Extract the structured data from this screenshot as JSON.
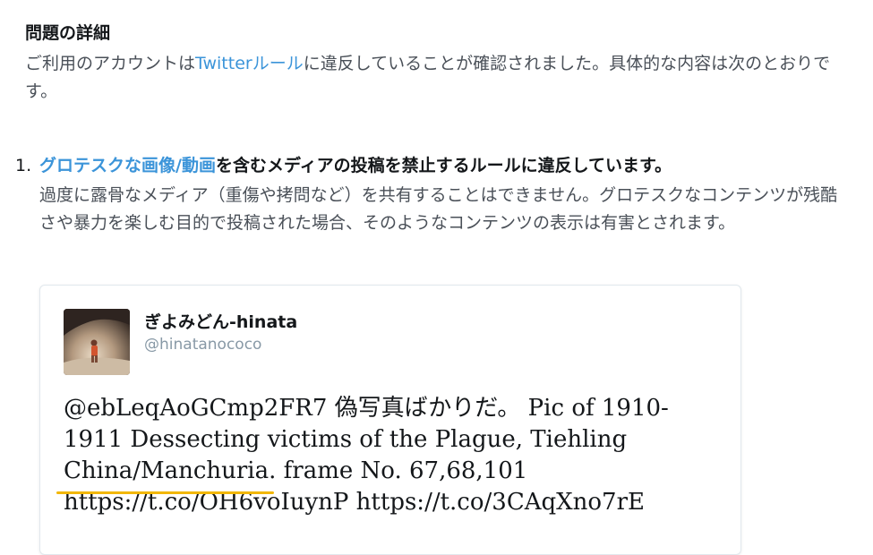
{
  "section": {
    "title": "問題の詳細",
    "intro_prefix": "ご利用のアカウントは",
    "intro_link": "Twitterルール",
    "intro_suffix": "に違反していることが確認されました。具体的な内容は次のとおりです。"
  },
  "violation": {
    "number": "1.",
    "head_link": "グロテスクな画像/動画",
    "head_rest": "を含むメディアの投稿を禁止するルールに違反しています。",
    "body": "過度に露骨なメディア（重傷や拷問など）を共有することはできません。グロテスクなコンテンツが残酷さや暴力を楽しむ目的で投稿された場合、そのようなコンテンツの表示は有害とされます。"
  },
  "tweet": {
    "display_name": "ぎよみどん-hinata",
    "handle": "@hinatanococo",
    "text_before": "@ebLeqAoGCmp2FR7 偽写真ばかりだ。 Pic of 1910-1911 Dessecting victims of the Plague, Tiehling ",
    "text_highlight": "China/Manchuria",
    "text_after": ". frame No. 67,68,101 https://t.co/OH6voIuynP https://t.co/3CAqXno7rE",
    "highlight_color": "#f2b705",
    "avatar_icon": "profile-photo"
  }
}
